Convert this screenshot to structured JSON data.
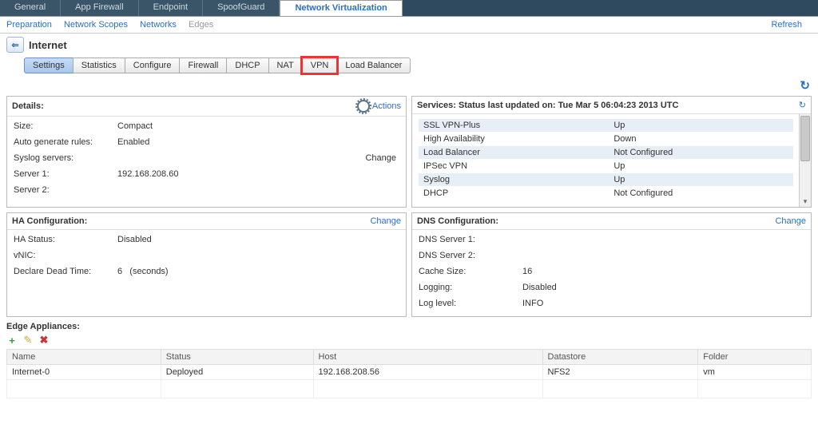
{
  "topTabs": {
    "items": [
      "General",
      "App Firewall",
      "Endpoint",
      "SpoofGuard",
      "Network Virtualization"
    ],
    "activeIndex": 4
  },
  "subNav": {
    "items": [
      "Preparation",
      "Network Scopes",
      "Networks",
      "Edges"
    ],
    "disabledIndex": 3,
    "refresh": "Refresh"
  },
  "header": {
    "title": "Internet"
  },
  "segTabs": {
    "items": [
      "Settings",
      "Statistics",
      "Configure",
      "Firewall",
      "DHCP",
      "NAT",
      "VPN",
      "Load Balancer"
    ],
    "activeIndex": 0,
    "highlightIndex": 6
  },
  "details": {
    "title": "Details:",
    "actionsLabel": "Actions",
    "changeLabel": "Change",
    "rows": {
      "sizeLabel": "Size:",
      "sizeValue": "Compact",
      "autoGenLabel": "Auto generate rules:",
      "autoGenValue": "Enabled",
      "syslogLabel": "Syslog servers:",
      "server1Label": "Server 1:",
      "server1Value": "192.168.208.60",
      "server2Label": "Server 2:",
      "server2Value": ""
    }
  },
  "services": {
    "title": "Services: Status last updated on: Tue Mar 5 06:04:23 2013 UTC",
    "rows": [
      {
        "name": "SSL VPN-Plus",
        "status": "Up"
      },
      {
        "name": "High Availability",
        "status": "Down"
      },
      {
        "name": "Load Balancer",
        "status": "Not Configured"
      },
      {
        "name": "IPSec VPN",
        "status": "Up"
      },
      {
        "name": "Syslog",
        "status": "Up"
      },
      {
        "name": "DHCP",
        "status": "Not Configured"
      }
    ]
  },
  "ha": {
    "title": "HA Configuration:",
    "changeLabel": "Change",
    "statusLabel": "HA Status:",
    "statusValue": "Disabled",
    "vnicLabel": "vNIC:",
    "vnicValue": "",
    "deadLabel": "Declare Dead Time:",
    "deadValue": "6",
    "deadUnit": "(seconds)"
  },
  "dns": {
    "title": "DNS Configuration:",
    "changeLabel": "Change",
    "s1Label": "DNS Server 1:",
    "s1Value": "",
    "s2Label": "DNS Server 2:",
    "s2Value": "",
    "cacheLabel": "Cache Size:",
    "cacheValue": "16",
    "logLabel": "Logging:",
    "logValue": "Disabled",
    "levelLabel": "Log level:",
    "levelValue": "INFO"
  },
  "edge": {
    "title": "Edge Appliances:",
    "columns": [
      "Name",
      "Status",
      "Host",
      "Datastore",
      "Folder"
    ],
    "rows": [
      {
        "name": "Internet-0",
        "status": "Deployed",
        "host": "192.168.208.56",
        "datastore": "NFS2",
        "folder": "vm"
      }
    ]
  }
}
